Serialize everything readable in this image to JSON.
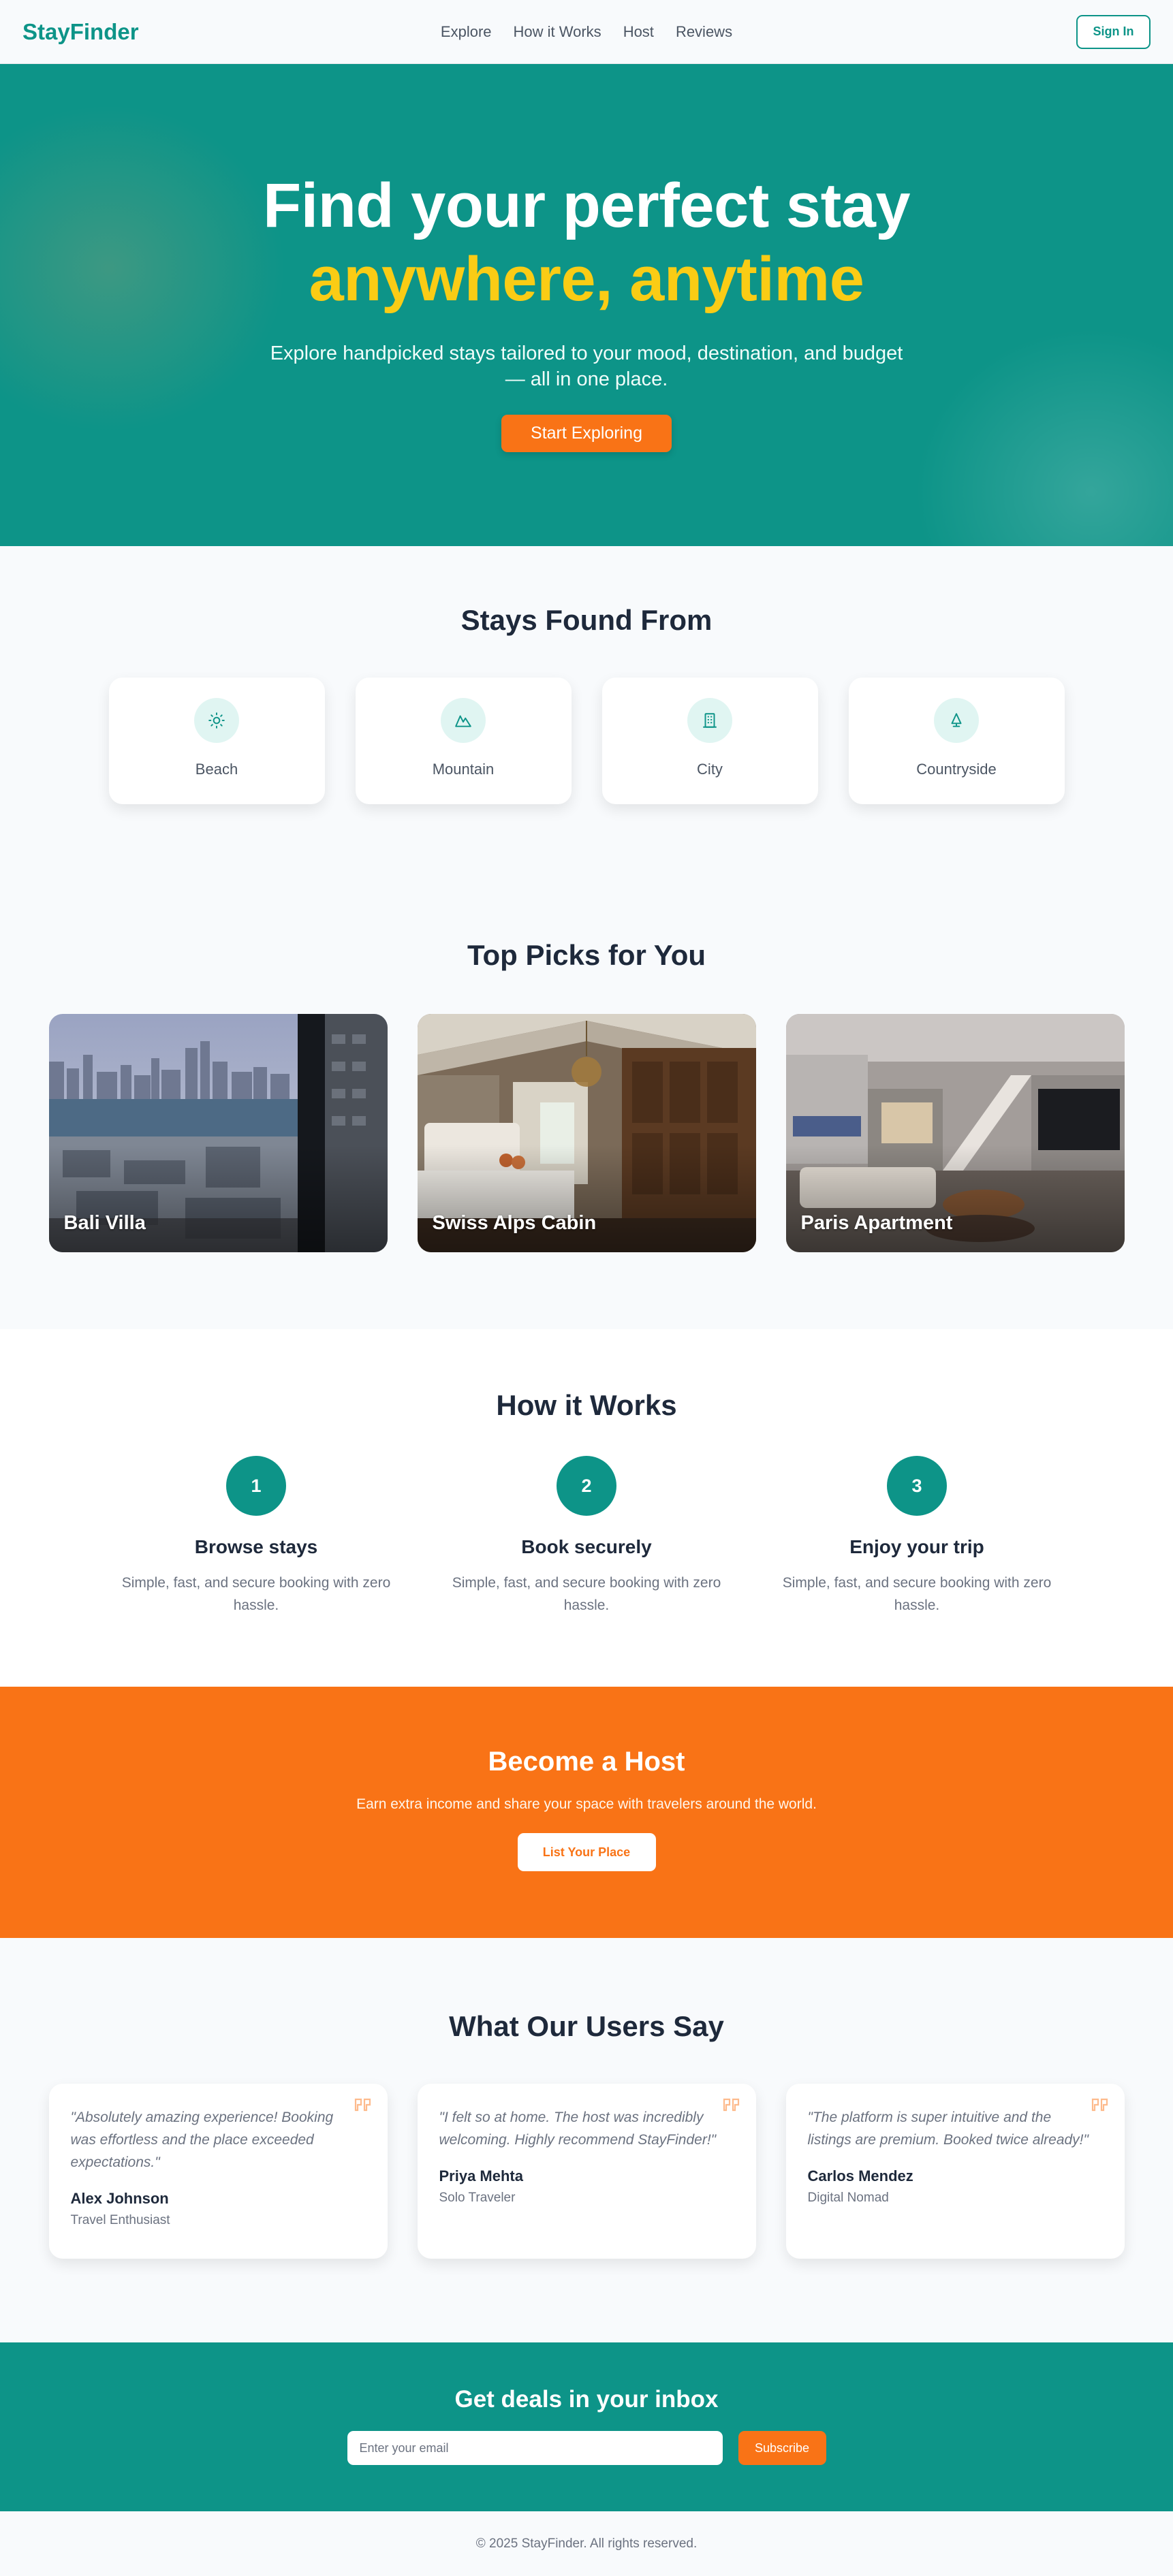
{
  "nav": {
    "logo": "StayFinder",
    "links": [
      "Explore",
      "How it Works",
      "Host",
      "Reviews"
    ],
    "signin": "Sign In"
  },
  "hero": {
    "title_line1": "Find your perfect stay",
    "title_line2": "anywhere, anytime",
    "subtitle": "Explore handpicked stays tailored to your mood, destination, and budget — all in one place.",
    "cta": "Start Exploring"
  },
  "stays": {
    "title": "Stays Found From",
    "items": [
      {
        "label": "Beach",
        "icon": "sun-icon"
      },
      {
        "label": "Mountain",
        "icon": "mountain-icon"
      },
      {
        "label": "City",
        "icon": "building-icon"
      },
      {
        "label": "Countryside",
        "icon": "tree-icon"
      }
    ]
  },
  "picks": {
    "title": "Top Picks for You",
    "items": [
      {
        "title": "Bali Villa"
      },
      {
        "title": "Swiss Alps Cabin"
      },
      {
        "title": "Paris Apartment"
      }
    ]
  },
  "how": {
    "title": "How it Works",
    "steps": [
      {
        "num": "1",
        "title": "Browse stays",
        "desc": "Simple, fast, and secure booking with zero hassle."
      },
      {
        "num": "2",
        "title": "Book securely",
        "desc": "Simple, fast, and secure booking with zero hassle."
      },
      {
        "num": "3",
        "title": "Enjoy your trip",
        "desc": "Simple, fast, and secure booking with zero hassle."
      }
    ]
  },
  "host": {
    "title": "Become a Host",
    "subtitle": "Earn extra income and share your space with travelers around the world.",
    "button": "List Your Place"
  },
  "reviews": {
    "title": "What Our Users Say",
    "items": [
      {
        "quote": "\"Absolutely amazing experience! Booking was effortless and the place exceeded expectations.\"",
        "name": "Alex Johnson",
        "role": "Travel Enthusiast"
      },
      {
        "quote": "\"I felt so at home. The host was incredibly welcoming. Highly recommend StayFinder!\"",
        "name": "Priya Mehta",
        "role": "Solo Traveler"
      },
      {
        "quote": "\"The platform is super intuitive and the listings are premium. Booked twice already!\"",
        "name": "Carlos Mendez",
        "role": "Digital Nomad"
      }
    ]
  },
  "deals": {
    "title": "Get deals in your inbox",
    "placeholder": "Enter your email",
    "button": "Subscribe"
  },
  "footer": {
    "text": "© 2025 StayFinder. All rights reserved."
  },
  "colors": {
    "teal": "#0d9488",
    "orange": "#f97316",
    "yellow": "#facc15"
  }
}
